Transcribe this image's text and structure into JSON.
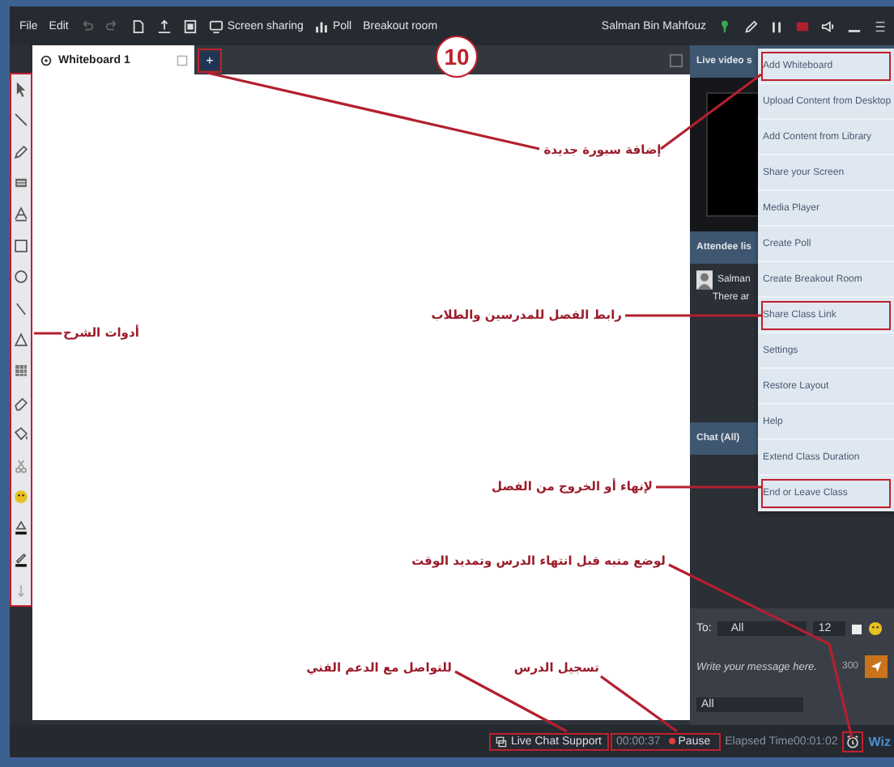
{
  "step_number": "10",
  "top_bar": {
    "menus": [
      {
        "label": "File"
      },
      {
        "label": "Edit"
      }
    ],
    "tools": [
      {
        "label": "Screen sharing",
        "kind": "screen"
      },
      {
        "label": "Poll",
        "kind": "poll"
      },
      {
        "label": "Breakout room",
        "kind": "plain"
      }
    ],
    "user": "Salman Bin Mahfouz"
  },
  "whiteboard": {
    "tabs": [
      {
        "label": "Whiteboard 1",
        "selected": true
      }
    ],
    "add_tab": "+"
  },
  "right_panel": {
    "video_header": "Live video s",
    "attendee_header": "Attendee lis",
    "attendees": [
      {
        "name": "Salman"
      }
    ],
    "attendee_note": "There ar",
    "chat_header": "Chat (All)",
    "chat": {
      "to_label": "To:",
      "to_value": "All",
      "font_size": "12",
      "checked": false,
      "placeholder": "Write your message here.",
      "char_count": "300",
      "audience": "All"
    }
  },
  "menu": {
    "items": [
      {
        "label": "Add Whiteboard",
        "highlighted": true
      },
      {
        "label": "Upload Content from Desktop",
        "highlighted": false
      },
      {
        "label": "Add Content from Library",
        "highlighted": false
      },
      {
        "label": "Share your Screen",
        "highlighted": false
      },
      {
        "label": "Media Player",
        "highlighted": false
      },
      {
        "label": "Create Poll",
        "highlighted": false
      },
      {
        "label": "Create Breakout Room",
        "highlighted": false
      },
      {
        "label": "Share Class Link",
        "highlighted": true
      },
      {
        "label": "Settings",
        "highlighted": false
      },
      {
        "label": "Restore Layout",
        "highlighted": false
      },
      {
        "label": "Help",
        "highlighted": false
      },
      {
        "label": "Extend Class Duration",
        "highlighted": false
      },
      {
        "label": "End or Leave Class",
        "highlighted": true
      }
    ]
  },
  "status_bar": {
    "live_chat": "Live Chat Support",
    "recording_time": "00:00:37",
    "pause": "Pause",
    "elapsed": "Elapsed Time00:01:02",
    "logo": "Wiz"
  },
  "annotations": [
    {
      "text": "إضافة سبورة جديدة"
    },
    {
      "text": "رابط الفصل للمدرسين والطلاب"
    },
    {
      "text": "أدوات الشرح"
    },
    {
      "text": "لإنهاء أو الخروج من الفصل"
    },
    {
      "text": "لوضع منبه قبل انتهاء الدرس وتمديد الوقت"
    },
    {
      "text": "تسجيل الدرس"
    },
    {
      "text": "للتواصل مع الدعم الفني"
    }
  ]
}
